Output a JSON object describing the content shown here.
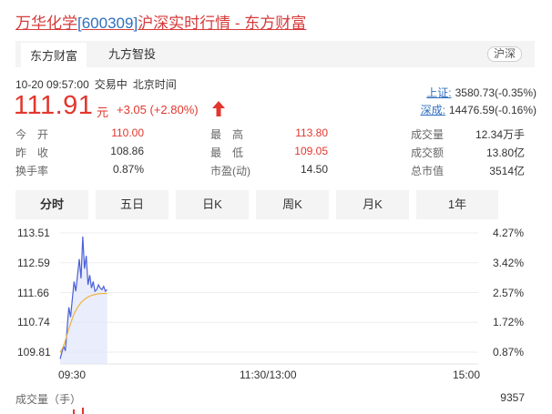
{
  "header": {
    "stock_name": "万华化学",
    "stock_code": "[600309]",
    "title_suffix": "沪深实时行情 - 东方财富"
  },
  "source_tabs": [
    {
      "label": "东方财富",
      "active": true
    },
    {
      "label": "九方智投",
      "active": false
    }
  ],
  "market_tag": "沪深",
  "quote_time": {
    "datetime": "10-20 09:57:00",
    "status": "交易中",
    "timezone": "北京时间"
  },
  "price": {
    "last": "111.91",
    "unit": "元",
    "change": "+3.05 (+2.80%)",
    "direction": "up",
    "color": "#e2372d"
  },
  "indices": [
    {
      "name": "上证:",
      "value": "3580.73(-0.35%)"
    },
    {
      "name": "深成:",
      "value": "14476.59(-0.16%)"
    }
  ],
  "stats": {
    "col1": [
      {
        "label": "今　开",
        "value": "110.00",
        "tone": "red"
      },
      {
        "label": "昨　收",
        "value": "108.86",
        "tone": "neutral"
      },
      {
        "label": "换手率",
        "value": "0.87%",
        "tone": "neutral"
      }
    ],
    "col2": [
      {
        "label": "最　高",
        "value": "113.80",
        "tone": "red"
      },
      {
        "label": "最　低",
        "value": "109.05",
        "tone": "red"
      },
      {
        "label": "市盈(动)",
        "value": "14.50",
        "tone": "neutral"
      }
    ],
    "col3": [
      {
        "label": "成交量",
        "value": "12.34万手",
        "tone": "neutral"
      },
      {
        "label": "成交额",
        "value": "13.80亿",
        "tone": "neutral"
      },
      {
        "label": "总市值",
        "value": "3514亿",
        "tone": "neutral"
      }
    ]
  },
  "kline_tabs": [
    {
      "label": "分时",
      "active": true
    },
    {
      "label": "五日",
      "active": false
    },
    {
      "label": "日K",
      "active": false
    },
    {
      "label": "周K",
      "active": false
    },
    {
      "label": "月K",
      "active": false
    },
    {
      "label": "1年",
      "active": false
    }
  ],
  "chart_data": {
    "type": "line",
    "title": "",
    "y_ticks": [
      "113.51",
      "112.59",
      "111.66",
      "110.74",
      "109.81"
    ],
    "y_pct_ticks": [
      "4.27%",
      "3.42%",
      "2.57%",
      "1.72%",
      "0.87%"
    ],
    "x_ticks": [
      "09:30",
      "11:30/13:00",
      "15:00"
    ],
    "ylim": [
      109.81,
      113.51
    ],
    "series": [
      {
        "role": "price",
        "color": "#4a5fd8",
        "x": [
          0,
          2,
          3,
          5,
          6,
          8,
          9,
          11,
          12,
          13,
          14,
          15,
          16,
          17,
          18,
          19,
          20,
          21,
          22,
          23,
          24,
          25,
          26,
          27
        ],
        "values": [
          109.6,
          110.0,
          109.85,
          111.2,
          110.9,
          112.0,
          111.7,
          112.7,
          112.1,
          113.4,
          112.4,
          112.8,
          111.9,
          112.2,
          111.8,
          112.0,
          111.7,
          111.75,
          111.9,
          111.8,
          111.75,
          111.85,
          111.7,
          111.75
        ]
      },
      {
        "role": "average",
        "color": "#f0b43c",
        "x": [
          0,
          2,
          4,
          6,
          8,
          10,
          12,
          14,
          16,
          18,
          20,
          22,
          24,
          27
        ],
        "values": [
          109.8,
          110.0,
          110.35,
          110.7,
          111.0,
          111.2,
          111.35,
          111.45,
          111.52,
          111.57,
          111.6,
          111.62,
          111.63,
          111.63
        ]
      }
    ],
    "x_session_minutes": 240,
    "volume": {
      "label": "成交量（手）",
      "max_label": "9357"
    }
  }
}
